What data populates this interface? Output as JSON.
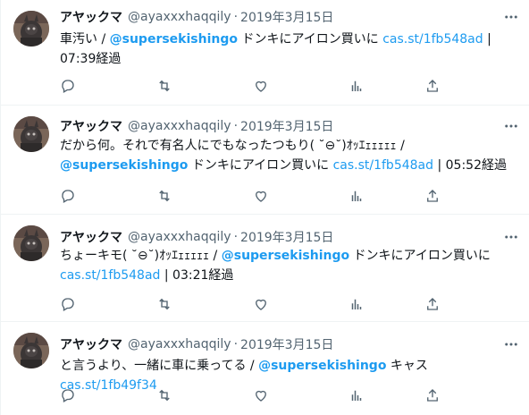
{
  "tweets": [
    {
      "name": "アヤックマ",
      "handle": "@ayaxxxhaqqily",
      "separator": "·",
      "date": "2019年3月15日",
      "text_pre": "車汚い / ",
      "mention": "@supersekishingo",
      "text_mid": " ドンキにアイロン買いに ",
      "link": "cas.st/1fb548ad",
      "text_post": " | 07:39経過"
    },
    {
      "name": "アヤックマ",
      "handle": "@ayaxxxhaqqily",
      "separator": "·",
      "date": "2019年3月15日",
      "text_pre": "だから何。それで有名人にでもなったつもり( ˘⊖˘)ｵｯｴｪｪｪｪｪ / ",
      "mention": "@supersekishingo",
      "text_mid": " ドンキにアイロン買いに ",
      "link": "cas.st/1fb548ad",
      "text_post": " | 05:52経過"
    },
    {
      "name": "アヤックマ",
      "handle": "@ayaxxxhaqqily",
      "separator": "·",
      "date": "2019年3月15日",
      "text_pre": "ちょーキモ( ˘⊖˘)ｵｯｴｪｪｪｪｪ / ",
      "mention": "@supersekishingo",
      "text_mid": " ドンキにアイロン買いに ",
      "link": "cas.st/1fb548ad",
      "text_post": " | 03:21経過"
    },
    {
      "name": "アヤックマ",
      "handle": "@ayaxxxhaqqily",
      "separator": "·",
      "date": "2019年3月15日",
      "text_pre": "と言うより、一緒に車に乗ってる / ",
      "mention": "@supersekishingo",
      "text_mid": " キャス ",
      "link": "cas.st/1fb49f34",
      "text_post": ""
    }
  ],
  "icons": [
    "more-icon",
    "reply-icon",
    "retweet-icon",
    "like-icon",
    "views-icon",
    "share-icon"
  ],
  "colors": {
    "link": "#1d9bf0",
    "secondary_text": "#536471",
    "divider": "#eff3f4"
  }
}
